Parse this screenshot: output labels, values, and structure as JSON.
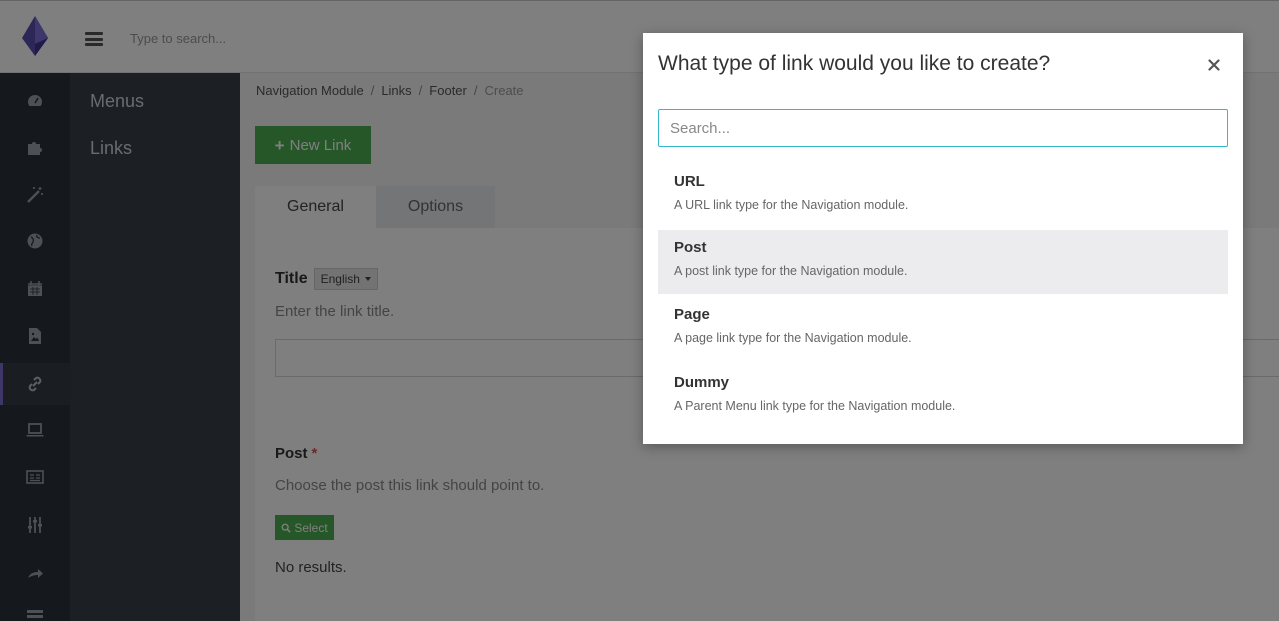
{
  "topbar": {
    "search_placeholder": "Type to search..."
  },
  "rail": {
    "icons": [
      "dashboard-icon",
      "puzzle-icon",
      "magic-wand-icon",
      "globe-icon",
      "calendar-icon",
      "image-icon",
      "link-icon",
      "laptop-icon",
      "newspaper-icon",
      "sliders-icon",
      "share-icon",
      "list-icon"
    ],
    "active": "link-icon"
  },
  "subnav": {
    "items": [
      {
        "label": "Menus"
      },
      {
        "label": "Links"
      }
    ]
  },
  "breadcrumb": {
    "items": [
      "Navigation Module",
      "Links",
      "Footer"
    ],
    "current": "Create",
    "separator": "/"
  },
  "main": {
    "new_link_label": "New Link",
    "tabs": [
      {
        "label": "General"
      },
      {
        "label": "Options"
      }
    ],
    "title_label": "Title",
    "language": "English",
    "title_hint": "Enter the link title.",
    "post_label": "Post",
    "required_mark": "*",
    "post_hint": "Choose the post this link should point to.",
    "select_label": "Select",
    "no_results": "No results."
  },
  "modal": {
    "title": "What type of link would you like to create?",
    "close_glyph": "×",
    "search_placeholder": "Search...",
    "options": [
      {
        "name": "URL",
        "description": "A URL link type for the Navigation module."
      },
      {
        "name": "Post",
        "description": "A post link type for the Navigation module."
      },
      {
        "name": "Page",
        "description": "A page link type for the Navigation module."
      },
      {
        "name": "Dummy",
        "description": "A Parent Menu link type for the Navigation module."
      }
    ],
    "hovered_option": "Post"
  },
  "colors": {
    "accent_green": "#4caf50",
    "search_focus": "#35b8c9",
    "rail_bg": "#2b3038",
    "subnav_bg": "#383e47",
    "rail_active_marker": "#7c6dd1"
  }
}
